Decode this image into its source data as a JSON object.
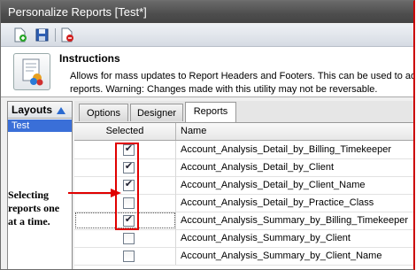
{
  "window": {
    "title": "Personalize Reports [Test*]"
  },
  "toolbar": {
    "buttons": [
      "new-report-icon",
      "save-icon",
      "delete-icon"
    ]
  },
  "instructions": {
    "title": "Instructions",
    "line1": "Allows for mass updates to Report Headers and Footers.  This can be used to add",
    "line2": "reports.  Warning: Changes made with this utility may not be reversable."
  },
  "layouts": {
    "title": "Layouts",
    "items": [
      "Test"
    ]
  },
  "tabs": [
    {
      "label": "Options",
      "active": false
    },
    {
      "label": "Designer",
      "active": false
    },
    {
      "label": "Reports",
      "active": true
    }
  ],
  "grid": {
    "columns": [
      "Selected",
      "Name"
    ],
    "rows": [
      {
        "name": "Account_Analysis_Detail_by_Billing_Timekeeper",
        "selected": true
      },
      {
        "name": "Account_Analysis_Detail_by_Client",
        "selected": true
      },
      {
        "name": "Account_Analysis_Detail_by_Client_Name",
        "selected": true
      },
      {
        "name": "Account_Analysis_Detail_by_Practice_Class",
        "selected": false
      },
      {
        "name": "Account_Analysis_Summary_by_Billing_Timekeeper",
        "selected": true
      },
      {
        "name": "Account_Analysis_Summary_by_Client",
        "selected": false
      },
      {
        "name": "Account_Analysis_Summary_by_Client_Name",
        "selected": false
      }
    ]
  },
  "annotation": {
    "text": "Selecting reports one at a time."
  },
  "colors": {
    "highlight": "#e00000",
    "selection": "#3a6fd8"
  }
}
